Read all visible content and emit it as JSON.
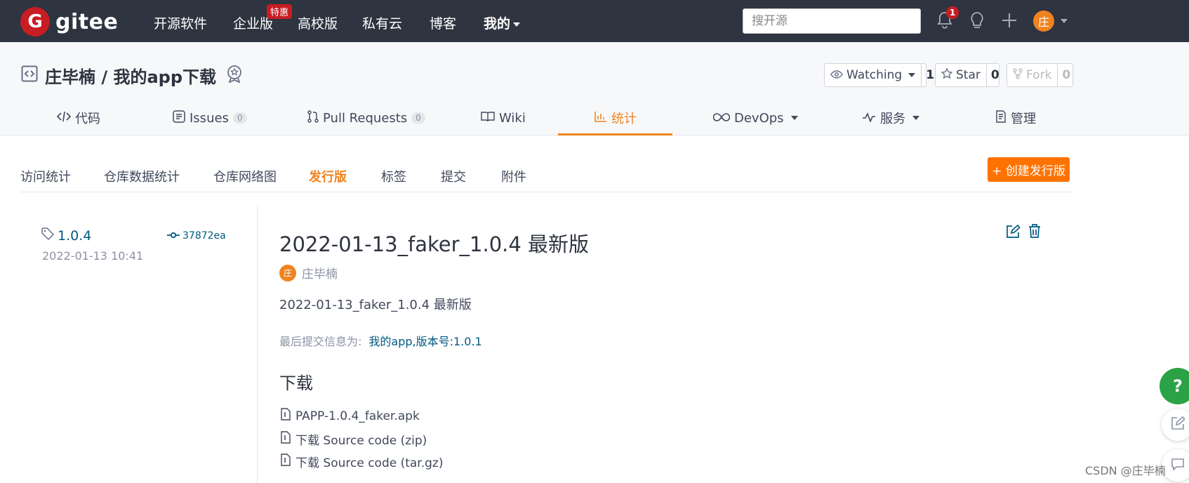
{
  "nav": {
    "logo_mark": "G",
    "logo_text": "gitee",
    "items": [
      "开源软件",
      "企业版",
      "高校版",
      "私有云",
      "博客",
      "我的"
    ],
    "enterprise_badge": "特惠",
    "search_placeholder": "搜开源",
    "notification_count": "1",
    "avatar": "庄"
  },
  "repo": {
    "title": "庄毕楠 / 我的app下载",
    "watching_label": "Watching",
    "watching_count": "1",
    "star_label": "Star",
    "star_count": "0",
    "fork_label": "Fork",
    "fork_count": "0"
  },
  "tabs": {
    "code": "代码",
    "issues": "Issues",
    "issues_count": "0",
    "pulls": "Pull Requests",
    "pulls_count": "0",
    "wiki": "Wiki",
    "stats": "统计",
    "devops": "DevOps",
    "services": "服务",
    "manage": "管理"
  },
  "subtabs": [
    "访问统计",
    "仓库数据统计",
    "仓库网络图",
    "发行版",
    "标签",
    "提交",
    "附件"
  ],
  "create_release": "+ 创建发行版",
  "release": {
    "tag": "1.0.4",
    "date": "2022-01-13 10:41",
    "commit": "37872ea",
    "title": "2022-01-13_faker_1.0.4 最新版",
    "author_avatar": "庄",
    "author": "庄毕楠",
    "description": "2022-01-13_faker_1.0.4 最新版",
    "last_commit_label": "最后提交信息为:",
    "last_commit_msg": "我的app,版本号:1.0.1",
    "download_title": "下载",
    "files": [
      "PAPP-1.0.4_faker.apk",
      "下载 Source code (zip)",
      "下载 Source code (tar.gz)"
    ]
  },
  "fab_help": "?",
  "watermark": "CSDN @庄毕楠",
  "colors": {
    "topbar": "#2e3440",
    "accent": "#f0831e",
    "primary_btn": "#fe7300",
    "link": "#005980",
    "help": "#2ba245"
  }
}
